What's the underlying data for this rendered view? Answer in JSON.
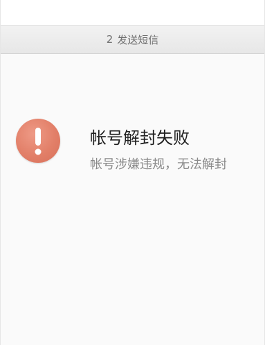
{
  "steps": {
    "current_number": "2",
    "current_label": "发送短信"
  },
  "result": {
    "icon": "exclamation-warning-icon",
    "title": "帐号解封失败",
    "description": "帐号涉嫌违规，无法解封"
  },
  "colors": {
    "icon_fill": "#e27f68",
    "title_text": "#1f1f1f",
    "desc_text": "#8a8a8a",
    "step_bar_bg": "#ececec"
  }
}
